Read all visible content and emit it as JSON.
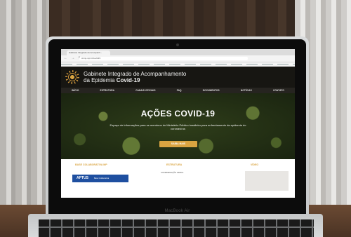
{
  "browser": {
    "tab_title": "Gabinete Integrado de Acompanh...",
    "url": "cnmp.mp.br/covid19",
    "nav_icons": "← → ↻"
  },
  "site": {
    "title_line1": "Gabinete Integrado de Acompanhamento",
    "title_line2_prefix": "da Epidemia ",
    "title_line2_bold": "Covid-19",
    "nav": [
      "INÍCIO",
      "ESTRUTURA",
      "CANAIS OFICIAIS",
      "FAQ",
      "DOCUMENTOS",
      "NOTÍCIAS",
      "CONTATO"
    ]
  },
  "hero": {
    "title": "AÇÕES COVID-19",
    "subtitle": "Espaço de informações para os membros do Ministério Público brasileiro para enfrentamento da epidemia do coronavírus",
    "button": "SAIBA MAIS"
  },
  "lower": {
    "col1": "BASE COLABORATIVA MP",
    "col2": "ESTRUTURA",
    "col2_sub": "COORDENAÇÃO GERAL",
    "col3": "VÍDEO",
    "aptus_logo": "APTUS",
    "aptus_caption": "Base Colaborativa"
  },
  "laptop": {
    "brand": "MacBook Air"
  }
}
